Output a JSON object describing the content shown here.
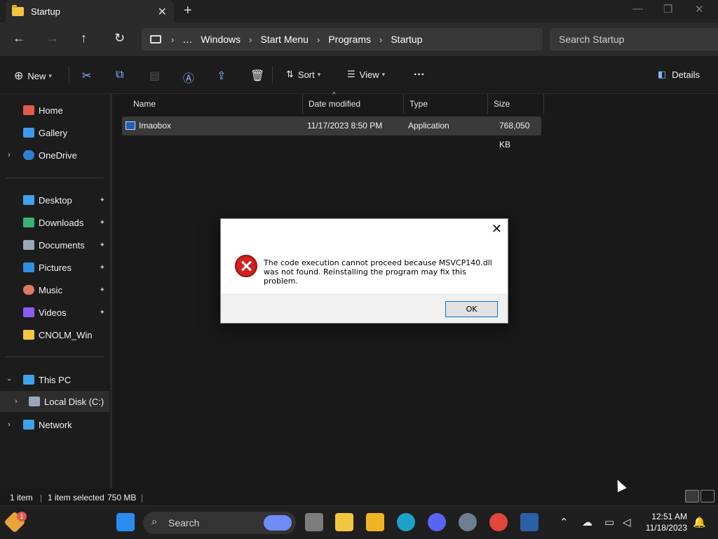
{
  "window": {
    "tab_title": "Startup",
    "tab_close": "✕",
    "new_tab": "+",
    "minimize": "—",
    "restore": "❐",
    "close": "✕"
  },
  "nav": {
    "back": "←",
    "forward": "→",
    "up": "↑",
    "refresh": "↻",
    "overflow": "…",
    "breadcrumbs": [
      "Windows",
      "Start Menu",
      "Programs",
      "Startup"
    ],
    "separator": "›",
    "search_placeholder": "Search Startup"
  },
  "commands": {
    "new_label": "New",
    "sort_label": "Sort",
    "view_label": "View",
    "more": "···",
    "details_label": "Details"
  },
  "sidebar": {
    "top": [
      {
        "label": "Home",
        "color": "#e05a4a"
      },
      {
        "label": "Gallery",
        "color": "#3b9bea"
      },
      {
        "label": "OneDrive",
        "color": "#2f7fd6"
      }
    ],
    "quick": [
      {
        "label": "Desktop",
        "color": "#3ea3e8",
        "pinned": true
      },
      {
        "label": "Downloads",
        "color": "#3bb273",
        "pinned": true
      },
      {
        "label": "Documents",
        "color": "#9aa7b8",
        "pinned": true
      },
      {
        "label": "Pictures",
        "color": "#2f8fe3",
        "pinned": true
      },
      {
        "label": "Music",
        "color": "#e07a5f",
        "pinned": true
      },
      {
        "label": "Videos",
        "color": "#8a5cf0",
        "pinned": true
      },
      {
        "label": "CNOLM_Win",
        "color": "#f4c542",
        "pinned": false
      }
    ],
    "this_pc": "This PC",
    "local_disk": "Local Disk (C:)",
    "network": "Network",
    "pin_glyph": "📌"
  },
  "file_list": {
    "columns": [
      "Name",
      "Date modified",
      "Type",
      "Size"
    ],
    "rows": [
      {
        "name": "Imaobox",
        "date": "11/17/2023 8:50 PM",
        "type": "Application",
        "size": "768,050 KB"
      }
    ]
  },
  "status": {
    "count": "1 item",
    "selected": "1 item selected",
    "size": "750 MB"
  },
  "dialog": {
    "message": "The code execution cannot proceed because MSVCP140.dll was not found. Reinstalling the program may fix this problem.",
    "ok_label": "OK",
    "close": "✕"
  },
  "taskbar": {
    "search_label": "Search",
    "time": "12:51 AM",
    "date": "11/18/2023",
    "notification_badge": "1"
  }
}
